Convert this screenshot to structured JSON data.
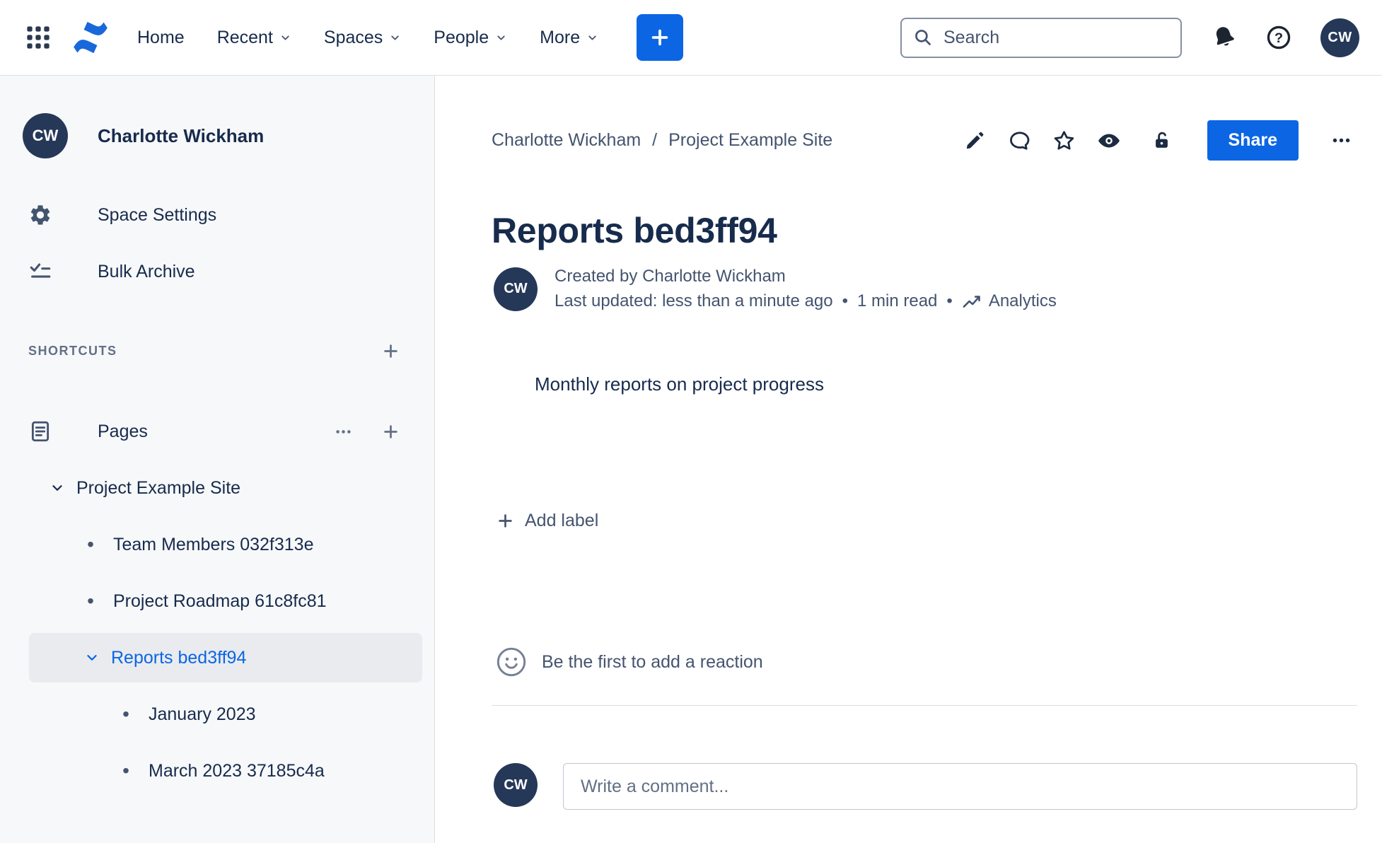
{
  "colors": {
    "brand": "#0c66e4",
    "navy": "#253858",
    "text": "#172b4d",
    "subtle": "#44546f",
    "muted": "#626f86",
    "sidebar_bg": "#f7f8f9",
    "border": "#dcdfe4",
    "selected_bg": "#e9ebee",
    "link_blue": "#0c66e4"
  },
  "topnav": {
    "items": [
      {
        "label": "Home",
        "caret": false
      },
      {
        "label": "Recent",
        "caret": true
      },
      {
        "label": "Spaces",
        "caret": true
      },
      {
        "label": "People",
        "caret": true
      },
      {
        "label": "More",
        "caret": true
      }
    ],
    "search_placeholder": "Search",
    "avatar_initials": "CW"
  },
  "sidebar": {
    "bullet": "•",
    "user": {
      "initials": "CW",
      "name": "Charlotte Wickham"
    },
    "menu": [
      {
        "label": "Space Settings"
      },
      {
        "label": "Bulk Archive"
      }
    ],
    "shortcuts_header": "SHORTCUTS",
    "pages_label": "Pages",
    "tree": [
      {
        "label": "Project Example Site",
        "level": 0,
        "marker": "chevron",
        "selected": false
      },
      {
        "label": "Team Members 032f313e",
        "level": 1,
        "marker": "bullet",
        "selected": false
      },
      {
        "label": "Project Roadmap 61c8fc81",
        "level": 1,
        "marker": "bullet",
        "selected": false
      },
      {
        "label": "Reports bed3ff94",
        "level": 1,
        "marker": "chevron",
        "selected": true
      },
      {
        "label": "January 2023",
        "level": 2,
        "marker": "bullet",
        "selected": false
      },
      {
        "label": "March 2023 37185c4a",
        "level": 2,
        "marker": "bullet",
        "selected": false
      }
    ]
  },
  "content": {
    "breadcrumb": {
      "items": [
        "Charlotte Wickham",
        "Project Example Site"
      ],
      "separator": "/"
    },
    "share_label": "Share",
    "title": "Reports bed3ff94",
    "byline": {
      "initials": "CW",
      "created": "Created by Charlotte Wickham",
      "updated": "Last updated: less than a minute ago",
      "dot": "•",
      "read_time": "1 min read",
      "analytics_label": "Analytics"
    },
    "body_text": "Monthly reports on project progress",
    "add_label_text": "Add label",
    "reaction_prompt": "Be the first to add a reaction",
    "comment": {
      "initials": "CW",
      "placeholder": "Write a comment..."
    }
  }
}
